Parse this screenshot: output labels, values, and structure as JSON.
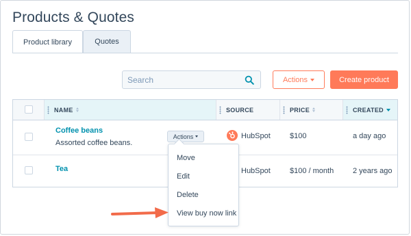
{
  "page": {
    "title": "Products & Quotes"
  },
  "tabs": [
    {
      "label": "Product library",
      "active": true
    },
    {
      "label": "Quotes",
      "active": false
    }
  ],
  "toolbar": {
    "search_placeholder": "Search",
    "actions_label": "Actions",
    "create_label": "Create product"
  },
  "table": {
    "columns": [
      {
        "label": "NAME",
        "sort": "none"
      },
      {
        "label": "SOURCE"
      },
      {
        "label": "PRICE",
        "sort": "none"
      },
      {
        "label": "CREATED",
        "sort": "desc"
      }
    ],
    "rows": [
      {
        "name": "Coffee beans",
        "description": "Assorted coffee beans.",
        "source": "HubSpot",
        "price": "$100",
        "created": "a day ago",
        "actions_label": "Actions"
      },
      {
        "name": "Tea",
        "description": "",
        "source": "HubSpot",
        "price": "$100 / month",
        "created": "2 years ago"
      }
    ]
  },
  "actions_menu": {
    "items": [
      "Move",
      "Edit",
      "Delete",
      "View buy now link"
    ]
  },
  "colors": {
    "accent": "#ff7a59",
    "link": "#0091ae",
    "text": "#33475b",
    "header_bg": "#f5f8fa",
    "highlight_bg": "#e5f5f8"
  },
  "icons": {
    "search": "search-icon",
    "source_logo": "hubspot-logo-icon",
    "pointer": "orange-arrow-icon"
  }
}
